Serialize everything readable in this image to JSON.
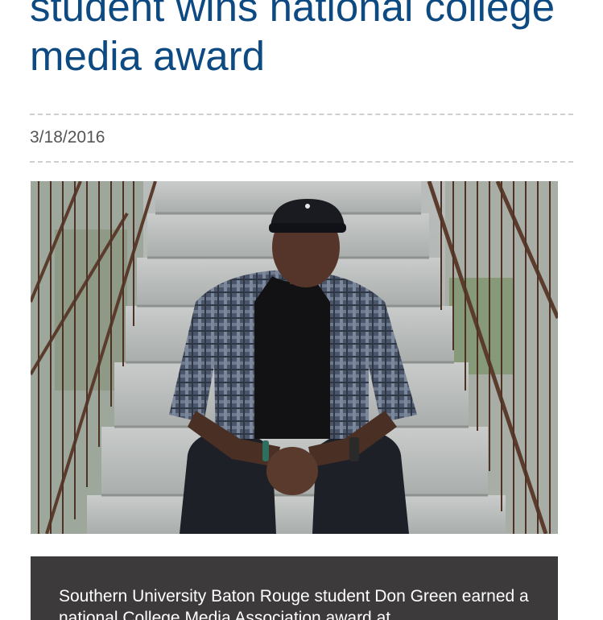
{
  "article": {
    "headline": "student wins national college media award",
    "date": "3/18/2016",
    "photo_alt": "Don Green sitting on concrete stairs",
    "caption": "Southern University Baton Rouge student Don Green earned a national College Media Association award at"
  },
  "colors": {
    "headline": "#0e4a82",
    "caption_background": "#3c3a3b",
    "divider": "#cfcfcf"
  }
}
